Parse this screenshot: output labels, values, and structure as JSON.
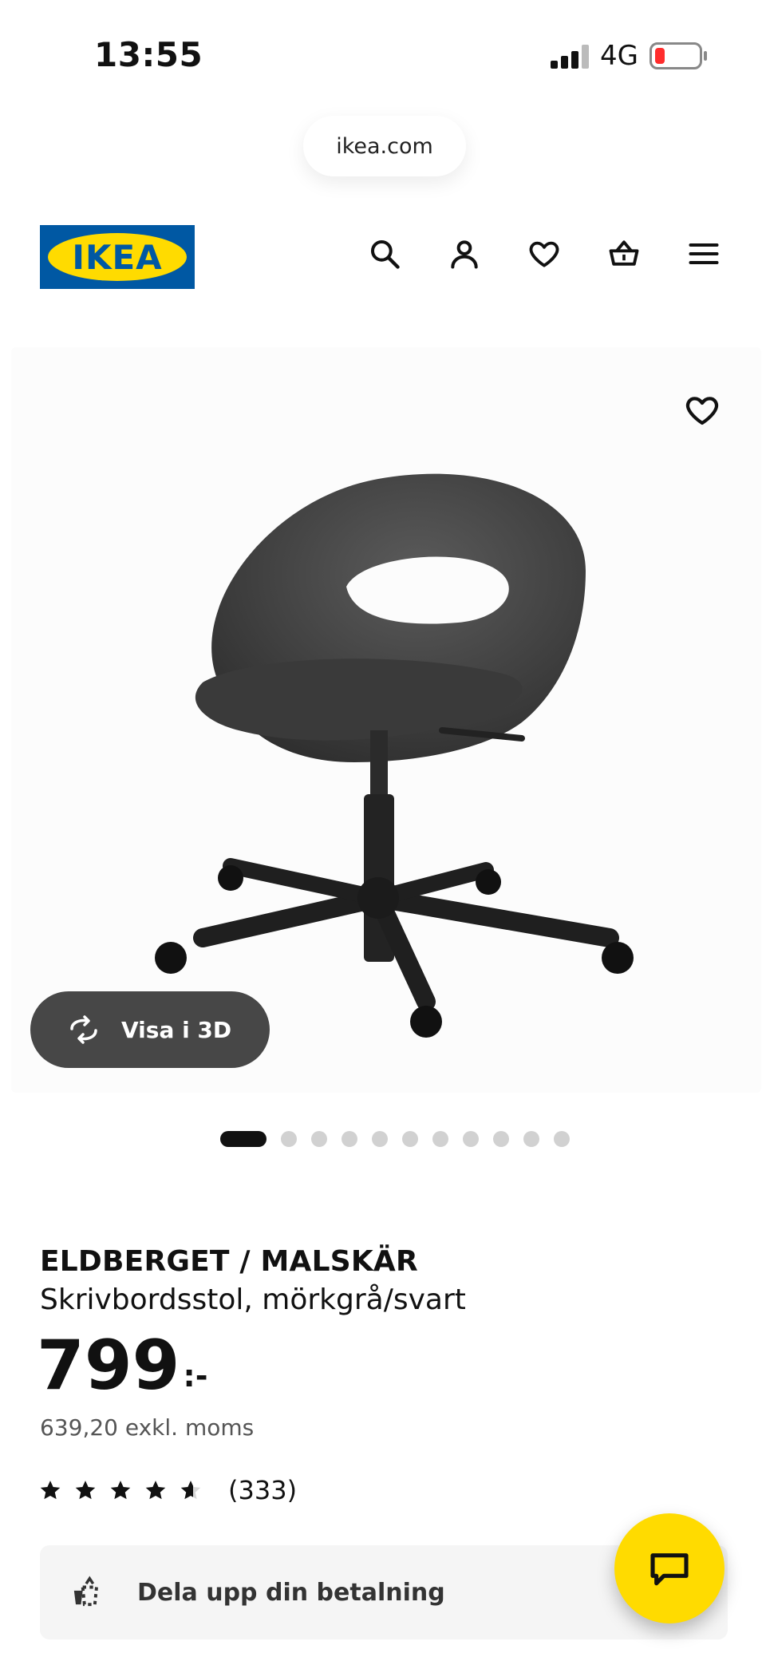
{
  "status_bar": {
    "time": "13:55",
    "network": "4G"
  },
  "browser": {
    "url": "ikea.com"
  },
  "header": {
    "brand": "IKEA",
    "icons": [
      "search-icon",
      "user-icon",
      "heart-icon",
      "basket-icon",
      "menu-icon"
    ]
  },
  "gallery": {
    "view3d_label": "Visa i 3D",
    "total_images": 11,
    "active_index": 1
  },
  "product": {
    "name": "ELDBERGET / MALSKÄR",
    "description": "Skrivbordsstol, mörkgrå/svart",
    "price": "799",
    "price_suffix": ":-",
    "price_ex_vat": "639,20 exkl. moms",
    "rating_value": 4.6,
    "rating_count": "(333)"
  },
  "payment": {
    "split_label": "Dela upp din betalning"
  },
  "colors": {
    "ikea_blue": "#0058a3",
    "ikea_yellow": "#ffdb00",
    "pill_dark": "#474747"
  }
}
